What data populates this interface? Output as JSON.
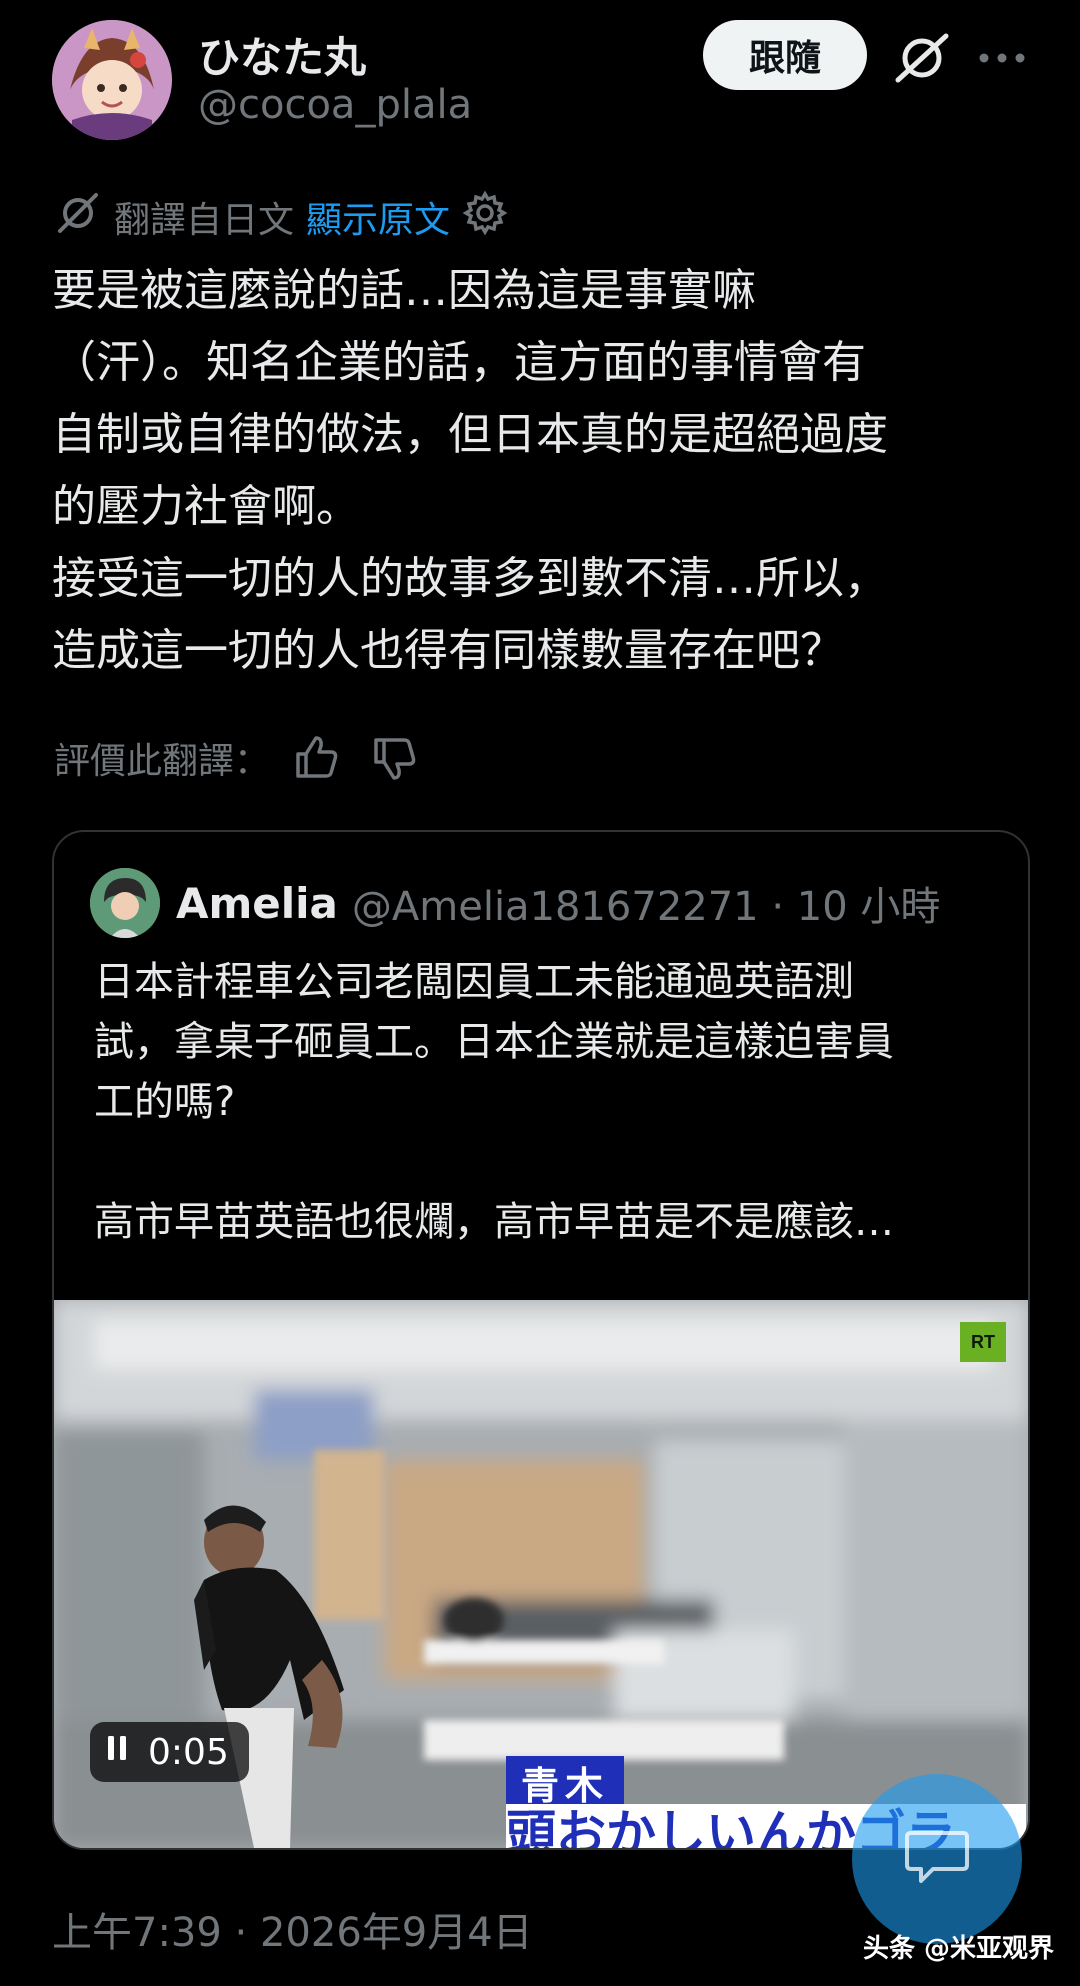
{
  "post": {
    "display_name": "ひなた丸",
    "handle": "@cocoa_plala",
    "follow_label": "跟隨",
    "translation": {
      "label": "翻譯自日文",
      "show_original": "顯示原文"
    },
    "body": "要是被這麼說的話…因為這是事實嘛\n（汗）。知名企業的話，這方面的事情會有\n自制或自律的做法，但日本真的是超絕過度\n的壓力社會啊。\n接受這一切的人的故事多到數不清…所以，\n造成這一切的人也得有同樣數量存在吧？",
    "rate_label": "評價此翻譯：",
    "timestamp": "上午7:39 · 2026年9月4日"
  },
  "quote": {
    "name": "Amelia",
    "handle_time": "@Amelia181672271 · 10 小時",
    "text": "日本計程車公司老闆因員工未能通過英語測\n試，拿桌子砸員工。日本企業就是這樣迫害員\n工的嗎?\n\n高市早苗英語也很爛，高市早苗是不是應該…",
    "video": {
      "channel_logo": "RT",
      "elapsed": "0:05",
      "caption_name": "青木",
      "caption_text": "頭おかしいんかゴラ"
    }
  },
  "watermark": "头条 @米亚观界",
  "colors": {
    "background": "#000000",
    "text": "#e7e9ea",
    "muted": "#71767b",
    "link": "#1d9bf0",
    "border": "#2f3336"
  },
  "icons": {
    "grok": "grok-icon",
    "more": "more-icon",
    "translate": "translate-icon",
    "settings": "gear-icon",
    "thumbs_up": "thumbs-up-icon",
    "thumbs_down": "thumbs-down-icon",
    "pause": "pause-icon",
    "compose": "compose-icon"
  }
}
